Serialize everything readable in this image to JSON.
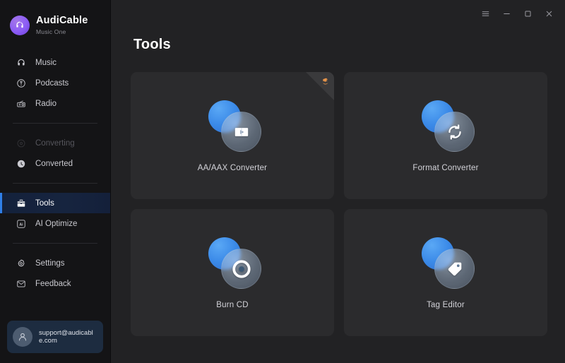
{
  "app": {
    "brand_name": "AudiCable",
    "brand_subtitle": "Music One",
    "accent_blue": "#2f7fe8",
    "brand_purple": "#8b5cf6",
    "window_bg": "#222224",
    "sidebar_bg": "#141416",
    "card_bg": "#2b2b2d",
    "ribbon_orange": "#e8954a"
  },
  "titlebar": {
    "menu_label": "menu-icon",
    "minimize_label": "minimize-icon",
    "maximize_label": "maximize-icon",
    "close_label": "close-icon"
  },
  "sidebar": {
    "items": [
      {
        "label": "Music",
        "icon": "headphones-icon",
        "state": "normal"
      },
      {
        "label": "Podcasts",
        "icon": "podcast-icon",
        "state": "normal"
      },
      {
        "label": "Radio",
        "icon": "radio-icon",
        "state": "normal"
      },
      {
        "label": "Converting",
        "icon": "converting-icon",
        "state": "disabled"
      },
      {
        "label": "Converted",
        "icon": "clock-icon",
        "state": "normal"
      },
      {
        "label": "Tools",
        "icon": "toolbox-icon",
        "state": "active"
      },
      {
        "label": "AI Optimize",
        "icon": "ai-icon",
        "state": "normal"
      },
      {
        "label": "Settings",
        "icon": "gear-icon",
        "state": "normal"
      },
      {
        "label": "Feedback",
        "icon": "message-icon",
        "state": "normal"
      }
    ],
    "account": {
      "email": "support@audicable.com",
      "avatar": "user-avatar-icon"
    }
  },
  "main": {
    "page_title": "Tools",
    "cards": [
      {
        "label": "AA/AAX Converter",
        "icon": "play-book-icon",
        "badge": "audible-badge"
      },
      {
        "label": "Format Converter",
        "icon": "refresh-icon",
        "badge": null
      },
      {
        "label": "Burn CD",
        "icon": "disc-icon",
        "badge": null
      },
      {
        "label": "Tag Editor",
        "icon": "tag-icon",
        "badge": null
      }
    ]
  }
}
